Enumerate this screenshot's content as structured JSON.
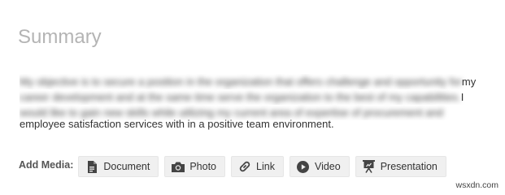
{
  "summary": {
    "title": "Summary",
    "lines": [
      {
        "blurred": "My objective is to secure a position in the organization that offers challenge and opportunity for",
        "clear": " my"
      },
      {
        "blurred": "career development and at the same time serve the organization to the best of my capabilities.",
        "clear": "  I"
      },
      {
        "blurred": "would like to gain new skills while utilizing my current area of expertise of procurement and",
        "clear": ""
      },
      {
        "blurred": "",
        "clear": "employee satisfaction services with in a positive team environment."
      }
    ]
  },
  "media": {
    "label": "Add Media:",
    "buttons": [
      {
        "label": "Document",
        "icon": "document-icon"
      },
      {
        "label": "Photo",
        "icon": "camera-icon"
      },
      {
        "label": "Link",
        "icon": "link-icon"
      },
      {
        "label": "Video",
        "icon": "play-icon"
      },
      {
        "label": "Presentation",
        "icon": "presentation-icon"
      }
    ]
  },
  "watermark": "wsxdn.com"
}
